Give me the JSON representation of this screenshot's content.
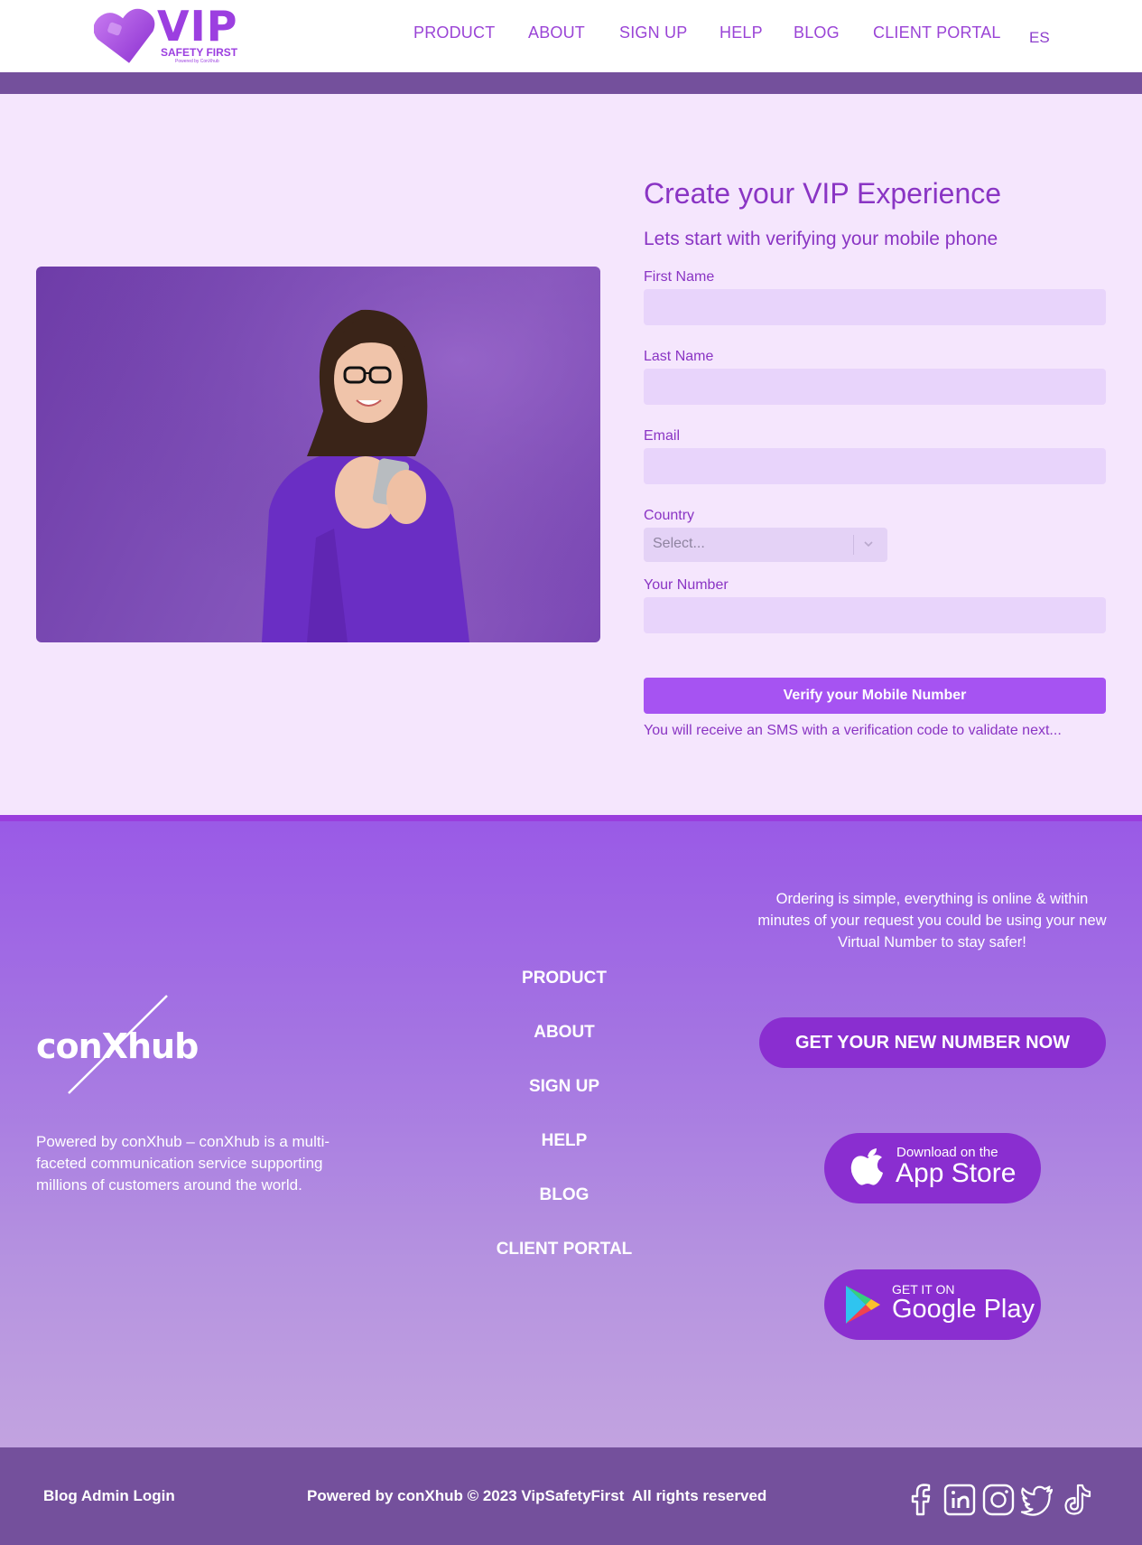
{
  "brand": {
    "name": "VIP",
    "tagline": "SAFETY FIRST",
    "powered": "Powered by ConXhub",
    "colors": {
      "primary": "#9a44d6",
      "band": "#74509c",
      "button": "#a653f2",
      "cta": "#8a2ed0"
    }
  },
  "nav": {
    "items": [
      {
        "label": "PRODUCT"
      },
      {
        "label": "ABOUT"
      },
      {
        "label": "SIGN UP"
      },
      {
        "label": "HELP"
      },
      {
        "label": "BLOG"
      },
      {
        "label": "CLIENT PORTAL"
      }
    ],
    "lang": "ES"
  },
  "form": {
    "title": "Create your VIP Experience",
    "subtitle": "Lets start with verifying your mobile phone",
    "first_name_label": "First Name",
    "last_name_label": "Last Name",
    "email_label": "Email",
    "country_label": "Country",
    "country_placeholder": "Select...",
    "number_label": "Your Number",
    "verify_button": "Verify your Mobile Number",
    "hint": "You will receive an SMS with a verification code to validate next..."
  },
  "footer": {
    "logo_text": "conXhub",
    "about": "Powered by conXhub – conXhub is a multi-faceted communication service supporting millions of customers around the world.",
    "nav": [
      {
        "label": "PRODUCT"
      },
      {
        "label": "ABOUT"
      },
      {
        "label": "SIGN UP"
      },
      {
        "label": "HELP"
      },
      {
        "label": "BLOG"
      },
      {
        "label": "CLIENT PORTAL"
      }
    ],
    "order_text": "Ordering is simple, everything is online & within minutes of your request you could be using your new Virtual Number to stay safer!",
    "cta_button": "GET YOUR NEW NUMBER NOW",
    "app_store": {
      "small": "Download on the",
      "big": "App Store"
    },
    "google_play": {
      "small": "GET IT ON",
      "big": "Google Play"
    }
  },
  "bottom": {
    "admin_link": "Blog Admin Login",
    "copyright": "Powered by conXhub © 2023 VipSafetyFirst",
    "rights": "All rights reserved",
    "social": [
      "facebook-icon",
      "linkedin-icon",
      "instagram-icon",
      "twitter-icon",
      "tiktok-icon"
    ]
  }
}
